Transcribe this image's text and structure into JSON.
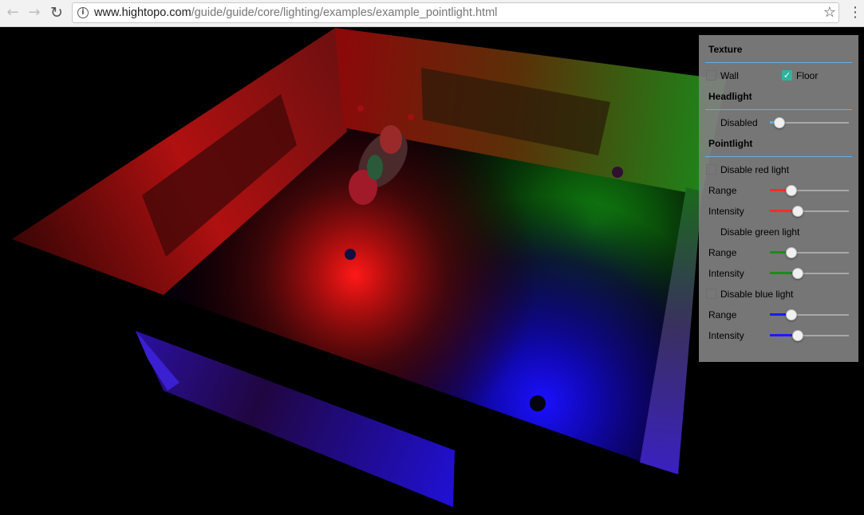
{
  "browser": {
    "back_glyph": "←",
    "forward_glyph": "→",
    "reload_glyph": "↻",
    "info_glyph": "i",
    "url_host": "www.hightopo.com",
    "url_path": "/guide/guide/core/lighting/examples/example_pointlight.html",
    "star_glyph": "☆",
    "menu_glyph": "⋮",
    "icons": [
      "back-arrow-icon",
      "forward-arrow-icon",
      "reload-icon",
      "info-icon",
      "bookmark-star-icon",
      "menu-dots-icon"
    ]
  },
  "panel": {
    "texture": {
      "title": "Texture",
      "wall_label": "Wall",
      "wall_checked": false,
      "floor_label": "Floor",
      "floor_checked": true
    },
    "headlight": {
      "title": "Headlight",
      "disabled_label": "Disabled",
      "disabled_checked": false,
      "level": 0.12
    },
    "pointlight": {
      "title": "Pointlight",
      "lights": [
        {
          "disable_label": "Disable red light",
          "checked": false,
          "color": "#ff2a2a",
          "range_label": "Range",
          "range_level": 0.27,
          "intensity_label": "Intensity",
          "intensity_level": 0.35
        },
        {
          "disable_label": "Disable green light",
          "checked": false,
          "color": "#1a8c1a",
          "range_label": "Range",
          "range_level": 0.27,
          "intensity_label": "Intensity",
          "intensity_level": 0.35
        },
        {
          "disable_label": "Disable blue light",
          "checked": false,
          "color": "#1a1aff",
          "range_label": "Range",
          "range_level": 0.27,
          "intensity_label": "Intensity",
          "intensity_level": 0.35
        }
      ]
    },
    "colors": {
      "accent_line": "#5fb0e8",
      "checkbox_checked": "#2db3a0"
    }
  },
  "scene": {
    "background": "#000000",
    "light_colors": {
      "red": "#ff2020",
      "green": "#20b020",
      "blue": "#2020ff"
    }
  }
}
